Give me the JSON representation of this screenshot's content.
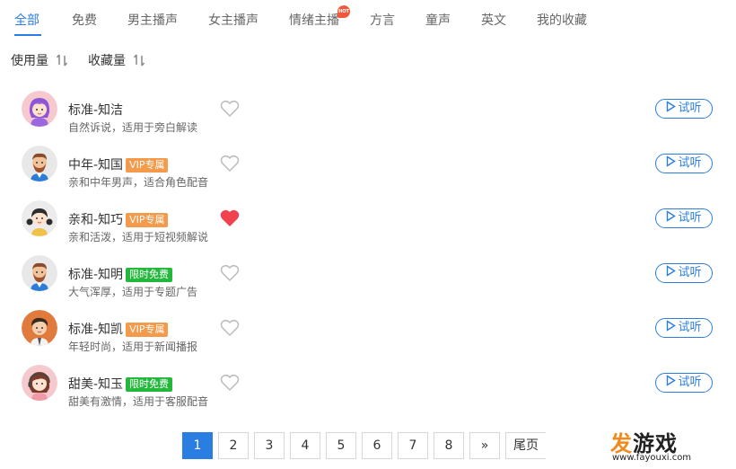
{
  "tabs": [
    {
      "label": "全部",
      "active": true
    },
    {
      "label": "免费"
    },
    {
      "label": "男主播声"
    },
    {
      "label": "女主播声"
    },
    {
      "label": "情绪主播",
      "hot": "HOT"
    },
    {
      "label": "方言"
    },
    {
      "label": "童声"
    },
    {
      "label": "英文"
    },
    {
      "label": "我的收藏"
    }
  ],
  "sort": [
    {
      "label": "使用量"
    },
    {
      "label": "收藏量"
    }
  ],
  "voices": [
    {
      "name": "标准-知洁",
      "badge": "",
      "desc": "自然诉说，适用于旁白解读",
      "favorited": false,
      "listen_label": "试听",
      "avatar": "purple-hair-girl"
    },
    {
      "name": "中年-知国",
      "badge": "VIP专属",
      "desc": "亲和中年男声，适合角色配音",
      "favorited": false,
      "listen_label": "试听",
      "avatar": "bearded-man"
    },
    {
      "name": "亲和-知巧",
      "badge": "VIP专属",
      "desc": "亲和活泼，适用于短视频解说",
      "favorited": true,
      "listen_label": "试听",
      "avatar": "pigtail-girl"
    },
    {
      "name": "标准-知明",
      "badge": "限时免费",
      "desc": "大气浑厚，适用于专题广告",
      "favorited": false,
      "listen_label": "试听",
      "avatar": "bearded-man"
    },
    {
      "name": "标准-知凯",
      "badge": "VIP专属",
      "desc": "年轻时尚，适用于新闻播报",
      "favorited": false,
      "listen_label": "试听",
      "avatar": "young-man"
    },
    {
      "name": "甜美-知玉",
      "badge": "限时免费",
      "desc": "甜美有激情，适用于客服配音",
      "favorited": false,
      "listen_label": "试听",
      "avatar": "headset-girl"
    }
  ],
  "pagination": {
    "pages": [
      "1",
      "2",
      "3",
      "4",
      "5",
      "6",
      "7",
      "8"
    ],
    "current": "1",
    "next": "»",
    "last": "尾页"
  },
  "watermark": {
    "logo_prefix": "发",
    "logo_rest": "游戏",
    "url": "www.fayouxi.com"
  },
  "colors": {
    "accent": "#2a7de1",
    "vip": "#f39a4b",
    "free": "#23b83c",
    "heart_active": "#f0424f",
    "hot": "#f05a3a"
  }
}
